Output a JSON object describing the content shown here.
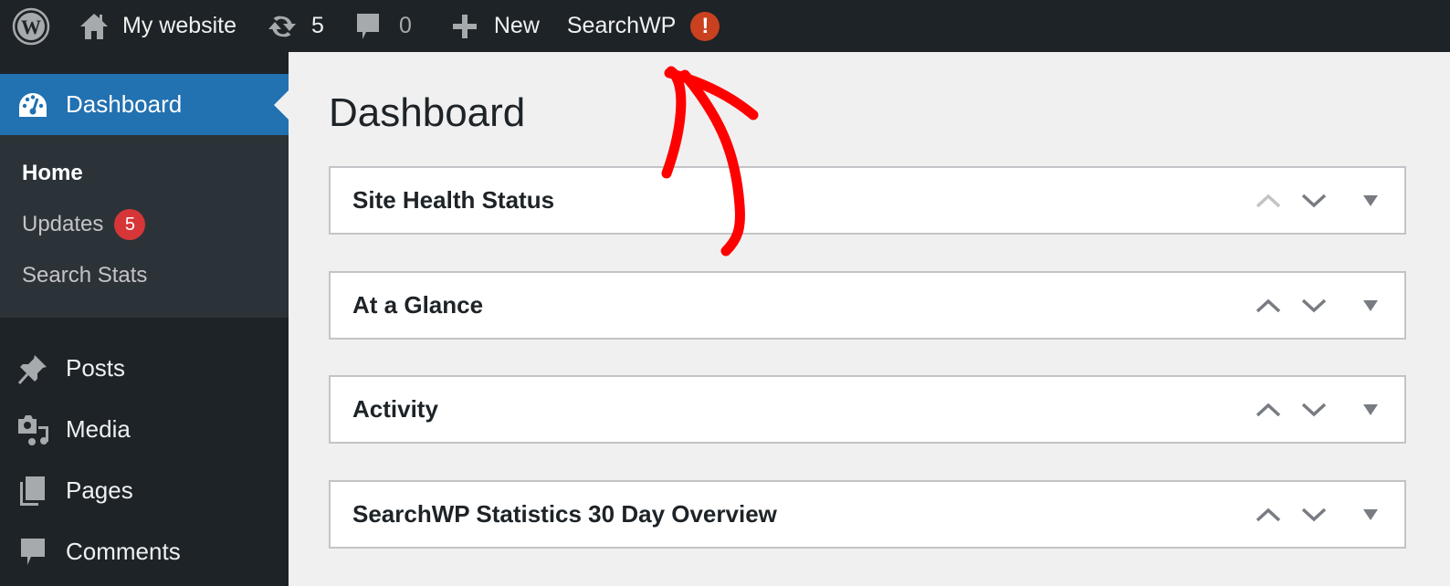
{
  "adminbar": {
    "site_name": "My website",
    "updates_count": "5",
    "comments_count": "0",
    "new_label": "New",
    "searchwp_label": "SearchWP",
    "searchwp_alert": "!"
  },
  "sidebar": {
    "current": {
      "label": "Dashboard",
      "icon": "dashboard-icon"
    },
    "submenu": [
      {
        "label": "Home",
        "active": true
      },
      {
        "label": "Updates",
        "badge": "5"
      },
      {
        "label": "Search Stats"
      }
    ],
    "items": [
      {
        "label": "Posts",
        "icon": "pushpin-icon"
      },
      {
        "label": "Media",
        "icon": "media-icon"
      },
      {
        "label": "Pages",
        "icon": "pages-icon"
      },
      {
        "label": "Comments",
        "icon": "comment-icon"
      }
    ]
  },
  "main": {
    "title": "Dashboard",
    "widgets": [
      {
        "title": "Site Health Status"
      },
      {
        "title": "At a Glance"
      },
      {
        "title": "Activity"
      },
      {
        "title": "SearchWP Statistics 30 Day Overview"
      }
    ]
  },
  "colors": {
    "accent": "#2271b1",
    "adminbar": "#1d2327",
    "annotation": "#ff0000",
    "badge": "#d63638",
    "alert": "#c9411f"
  }
}
